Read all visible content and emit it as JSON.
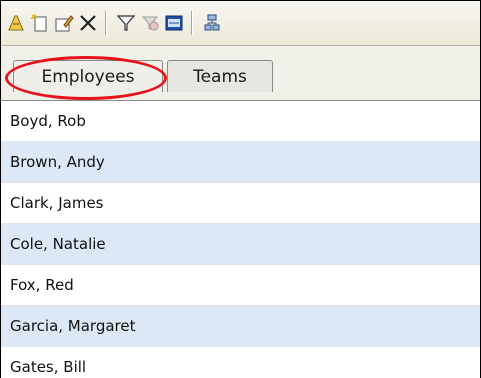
{
  "toolbar": {
    "buttons": [
      {
        "icon": "new-item-icon"
      },
      {
        "icon": "new-document-icon"
      },
      {
        "icon": "edit-properties-icon"
      },
      {
        "icon": "delete-icon"
      },
      {
        "icon": "filter-icon"
      },
      {
        "icon": "clear-filter-icon"
      },
      {
        "icon": "view-details-icon"
      },
      {
        "icon": "hierarchy-icon"
      }
    ]
  },
  "tabs": [
    {
      "label": "Employees",
      "selected": true,
      "highlighted": true
    },
    {
      "label": "Teams",
      "selected": false
    }
  ],
  "employees": [
    "Boyd, Rob",
    "Brown, Andy",
    "Clark, James",
    "Cole, Natalie",
    "Fox, Red",
    "Garcia, Margaret",
    "Gates, Bill"
  ],
  "colors": {
    "highlight": "#e8121b",
    "alt_row": "#dde8f6"
  }
}
